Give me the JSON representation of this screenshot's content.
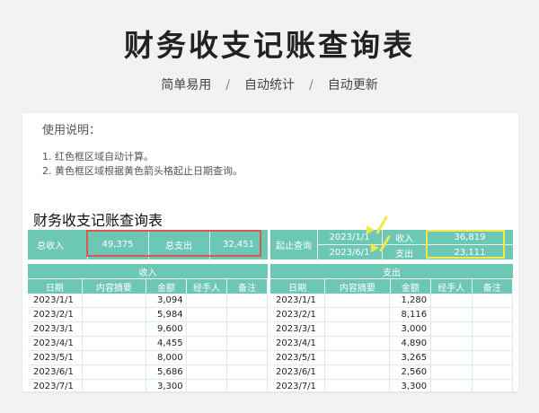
{
  "hero": {
    "title": "财务收支记账查询表",
    "features": [
      "简单易用",
      "自动统计",
      "自动更新"
    ],
    "separator": "/"
  },
  "instructions": {
    "title": "使用说明：",
    "lines": [
      "1. 红色框区域自动计算。",
      "2. 黄色框区域根据黄色箭头格起止日期查询。"
    ]
  },
  "sheet_title": "财务收支记账查询表",
  "summary": {
    "total_income_label": "总收入",
    "total_income_value": "49,375",
    "total_expense_label": "总支出",
    "total_expense_value": "32,451"
  },
  "query": {
    "label": "起止查询",
    "start_date": "2023/1/1",
    "end_date": "2023/6/1",
    "income_label": "收入",
    "income_value": "36,819",
    "expense_label": "支出",
    "expense_value": "23,111"
  },
  "income_table": {
    "title": "收入",
    "columns": [
      "日期",
      "内容摘要",
      "金额",
      "经手人",
      "备注"
    ],
    "rows": [
      {
        "date": "2023/1/1",
        "amount": "3,094"
      },
      {
        "date": "2023/2/1",
        "amount": "5,984"
      },
      {
        "date": "2023/3/1",
        "amount": "9,600"
      },
      {
        "date": "2023/4/1",
        "amount": "4,455"
      },
      {
        "date": "2023/5/1",
        "amount": "8,000"
      },
      {
        "date": "2023/6/1",
        "amount": "5,686"
      },
      {
        "date": "2023/7/1",
        "amount": "3,300"
      }
    ]
  },
  "expense_table": {
    "title": "支出",
    "columns": [
      "日期",
      "内容摘要",
      "金额",
      "经手人",
      "备注"
    ],
    "rows": [
      {
        "date": "2023/1/1",
        "amount": "1,280"
      },
      {
        "date": "2023/2/1",
        "amount": "8,116"
      },
      {
        "date": "2023/3/1",
        "amount": "3,000"
      },
      {
        "date": "2023/4/1",
        "amount": "4,890"
      },
      {
        "date": "2023/5/1",
        "amount": "3,265"
      },
      {
        "date": "2023/6/1",
        "amount": "2,560"
      },
      {
        "date": "2023/7/1",
        "amount": "3,300"
      }
    ]
  },
  "colors": {
    "accent": "#6cc7b5",
    "red_box": "#e0554f",
    "yellow_box": "#f2e84a"
  }
}
